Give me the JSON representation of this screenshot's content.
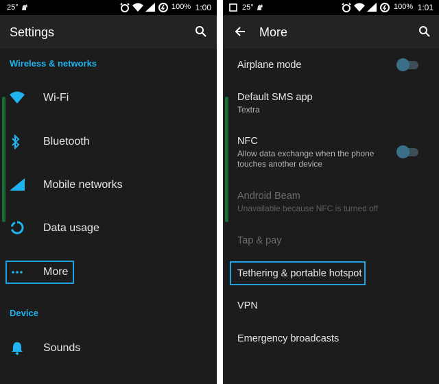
{
  "colors": {
    "accent": "#1fb4ef",
    "background": "#1c1c1c",
    "toolbar": "#232323",
    "statusbar": "#000000",
    "highlight": "#1fa0e0",
    "scrollbar": "#1b6b3a"
  },
  "left": {
    "status": {
      "temp": "25°",
      "battery": "100%",
      "time": "1:00"
    },
    "toolbar": {
      "title": "Settings",
      "search_icon": "search-icon"
    },
    "sections": [
      {
        "header": "Wireless & networks"
      },
      {
        "header": "Device"
      }
    ],
    "items": [
      {
        "label": "Wi-Fi",
        "icon": "wifi-icon"
      },
      {
        "label": "Bluetooth",
        "icon": "bluetooth-icon"
      },
      {
        "label": "Mobile networks",
        "icon": "signal-icon"
      },
      {
        "label": "Data usage",
        "icon": "data-usage-icon"
      },
      {
        "label": "More",
        "icon": "more-dots-icon"
      },
      {
        "label": "Sounds",
        "icon": "bell-icon"
      }
    ]
  },
  "right": {
    "status": {
      "temp": "25°",
      "battery": "100%",
      "time": "1:01"
    },
    "toolbar": {
      "title": "More",
      "back_icon": "back-arrow-icon",
      "search_icon": "search-icon"
    },
    "items": [
      {
        "title": "Airplane mode",
        "summary": "",
        "toggle": "off"
      },
      {
        "title": "Default SMS app",
        "summary": "Textra"
      },
      {
        "title": "NFC",
        "summary": "Allow data exchange when the phone touches another device",
        "toggle": "off"
      },
      {
        "title": "Android Beam",
        "summary": "Unavailable because NFC is turned off",
        "disabled": true
      },
      {
        "title": "Tap & pay",
        "summary": "",
        "disabled": true
      },
      {
        "title": "Tethering & portable hotspot",
        "summary": ""
      },
      {
        "title": "VPN",
        "summary": ""
      },
      {
        "title": "Emergency broadcasts",
        "summary": ""
      }
    ]
  }
}
